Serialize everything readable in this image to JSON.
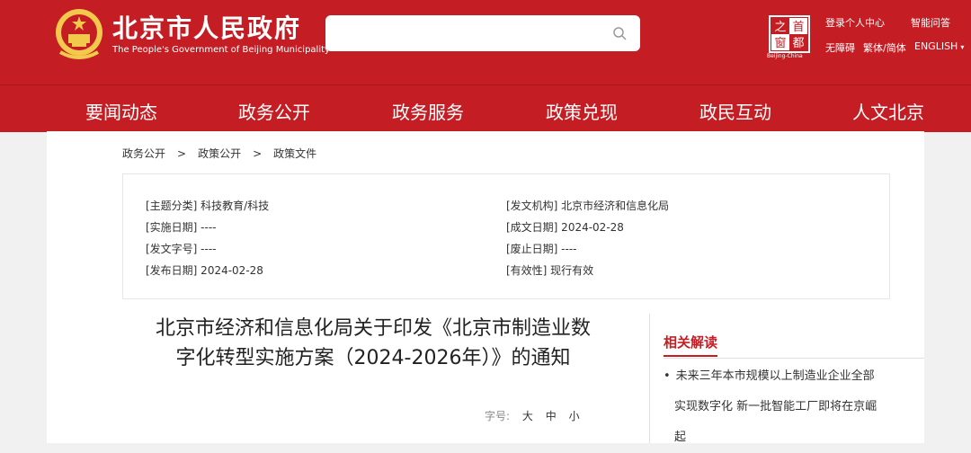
{
  "header": {
    "site_title": "北京市人民政府",
    "site_subtitle": "The People's Government of Beijing Municipality",
    "search": {
      "placeholder": ""
    },
    "seal": {
      "chars": [
        "首",
        "都",
        "之",
        "窗"
      ],
      "caption": "Beijing-China"
    },
    "links": {
      "login": "登录个人中心",
      "ask": "智能问答",
      "accessible": "无障碍",
      "trad_simp": "繁体/简体",
      "english": "ENGLISH"
    }
  },
  "nav": [
    "要闻动态",
    "政务公开",
    "政务服务",
    "政策兑现",
    "政民互动",
    "人文北京"
  ],
  "breadcrumb": [
    "政务公开",
    "政策公开",
    "政策文件"
  ],
  "info": {
    "category": "[主题分类] 科技教育/科技",
    "issuer": "[发文机构] 北京市经济和信息化局",
    "effective_date": "[实施日期] ----",
    "created_date": "[成文日期] 2024-02-28",
    "doc_number": "[发文字号] ----",
    "abolish_date": "[废止日期] ----",
    "publish_date": "[发布日期] 2024-02-28",
    "validity": "[有效性] 现行有效"
  },
  "document": {
    "title_line1": "北京市经济和信息化局关于印发《北京市制造业数",
    "title_line2": "字化转型实施方案（2024-2026年）》的通知",
    "font_size_label": "字号:",
    "font_size_options": [
      "大",
      "中",
      "小"
    ]
  },
  "related": {
    "heading": "相关解读",
    "items": [
      {
        "lines": [
          "未来三年本市规模以上制造业企业全部",
          "实现数字化 新一批智能工厂即将在京崛",
          "起"
        ]
      }
    ]
  },
  "colors": {
    "brand_red": "#c41e24",
    "emblem_gold": "#f2c94c"
  }
}
